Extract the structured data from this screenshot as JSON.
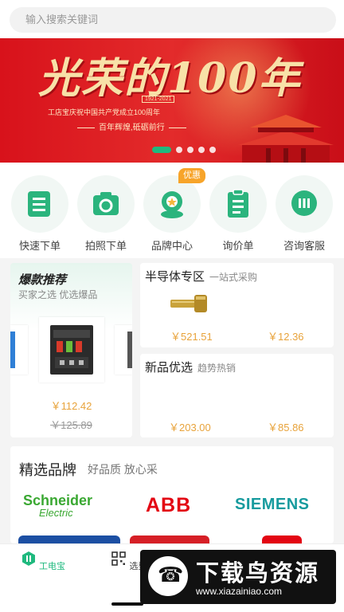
{
  "search": {
    "placeholder": "输入搜索关键词"
  },
  "banner": {
    "title": "光荣的100年",
    "years": "1921-2021",
    "subtitle1": "工店宝庆祝中国共产党成立100周年",
    "subtitle2": "百年辉煌,砥砺前行",
    "slide_count": 5,
    "active_slide": 1
  },
  "quick_menu": {
    "items": [
      {
        "label": "快速下单",
        "icon": "document-list-icon"
      },
      {
        "label": "拍照下单",
        "icon": "camera-icon"
      },
      {
        "label": "品牌中心",
        "icon": "brand-badge-icon"
      },
      {
        "label": "询价单",
        "icon": "clipboard-icon"
      },
      {
        "label": "咨询客服",
        "icon": "chat-bubble-icon"
      }
    ],
    "badge": "优惠"
  },
  "hot_sale": {
    "title": "爆款推荐",
    "subtitle": "买家之选 优选爆品",
    "price": "￥112.42",
    "old_price": "￥125.89"
  },
  "semiconductor": {
    "title": "半导体专区",
    "subtitle": "一站式采购",
    "price1": "￥521.51",
    "price2": "￥12.36"
  },
  "new_products": {
    "title": "新品优选",
    "subtitle": "趋势热销",
    "price1": "￥203.00",
    "price2": "￥85.86"
  },
  "brands": {
    "title": "精选品牌",
    "subtitle": "好品质 放心采",
    "logos": [
      "Schneider",
      "Electric",
      "ABB",
      "SIEMENS"
    ]
  },
  "tabbar": {
    "items": [
      {
        "label": "工电宝",
        "active": true
      },
      {
        "label": "选型",
        "active": false
      }
    ]
  },
  "watermark": {
    "title": "下载鸟资源",
    "url": "www.xiazainiao.com"
  },
  "colors": {
    "accent": "#1fb97e",
    "price": "#e8a33b",
    "banner_red": "#d8121b"
  }
}
